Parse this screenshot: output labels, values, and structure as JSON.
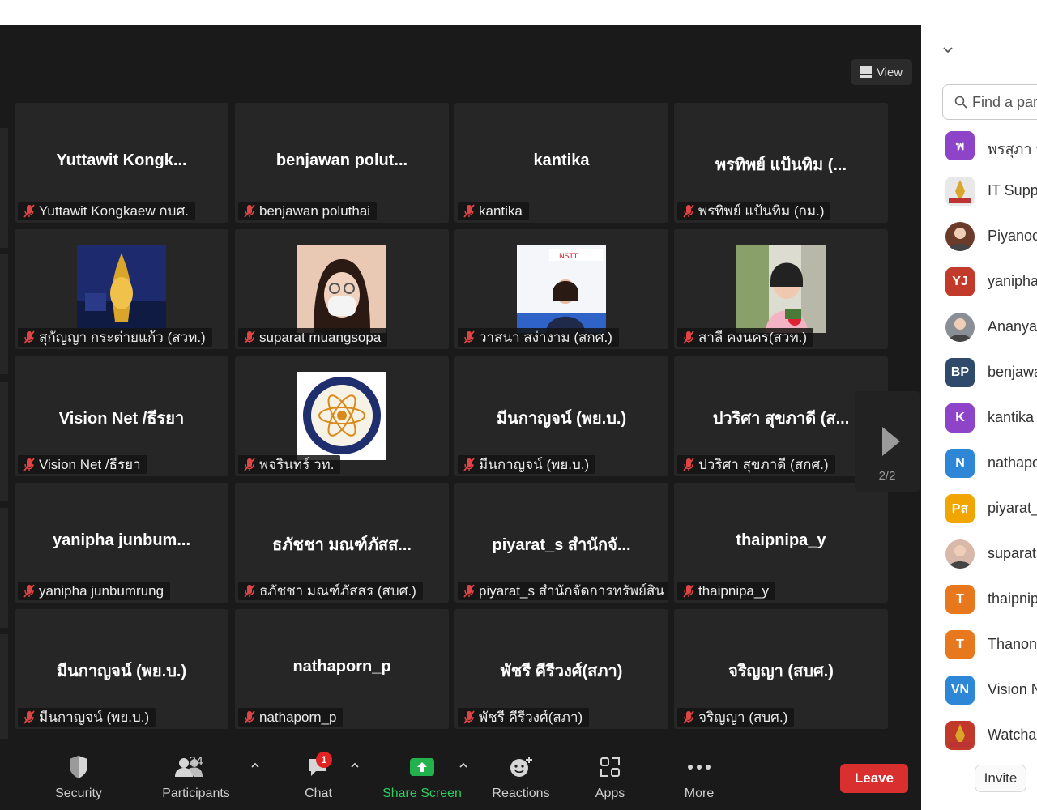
{
  "view_button": {
    "label": "View"
  },
  "tiles": [
    {
      "id": "r1c1",
      "big": "Yuttawit  Kongk...",
      "tag": "Yuttawit Kongkaew กบศ.",
      "video": false
    },
    {
      "id": "r1c2",
      "big": "benjawan  polut...",
      "tag": "benjawan poluthai",
      "video": false
    },
    {
      "id": "r1c3",
      "big": "kantika",
      "tag": "kantika",
      "video": false
    },
    {
      "id": "r1c4",
      "big": "พรทิพย์ แป้นทิม (...",
      "tag": "พรทิพย์ แป้นทิม (กม.)",
      "video": false
    },
    {
      "id": "r2c1",
      "big": "",
      "tag": "สุกัญญา กระต่ายแก้ว (สวท.)",
      "video": true
    },
    {
      "id": "r2c2",
      "big": "",
      "tag": "suparat muangsopa",
      "video": true
    },
    {
      "id": "r2c3",
      "big": "",
      "tag": "วาสนา สง่างาม (สกศ.)",
      "video": true
    },
    {
      "id": "r2c4",
      "big": "",
      "tag": "สาลี คงนคร(สวท.)",
      "video": true
    },
    {
      "id": "r3c1",
      "big": "Vision Net /ธีรยา",
      "tag": "Vision Net /ธีรยา",
      "video": false
    },
    {
      "id": "r3c2",
      "big": "",
      "tag": "พจรินทร์ วท.",
      "video": true
    },
    {
      "id": "r3c3",
      "big": "มีนกาญจน์ (พย.บ.)",
      "tag": "มีนกาญจน์ (พย.บ.)",
      "video": false
    },
    {
      "id": "r3c4",
      "big": "ปวริศา สุขภาดี (ส...",
      "tag": "ปวริศา สุขภาดี (สกศ.)",
      "video": false
    },
    {
      "id": "r4c1",
      "big": "yanipha  junbum...",
      "tag": "yanipha junbumrung",
      "video": false
    },
    {
      "id": "r4c2",
      "big": "ธภัชชา มณฑ์ภัสส...",
      "tag": "ธภัชชา มณฑ์ภัสสร (สบศ.)",
      "video": false
    },
    {
      "id": "r4c3",
      "big": "piyarat_s สำนักจั...",
      "tag": "piyarat_s สำนักจัดการทรัพย์สิน",
      "video": false
    },
    {
      "id": "r4c4",
      "big": "thaipnipa_y",
      "tag": "thaipnipa_y",
      "video": false
    },
    {
      "id": "r5c1",
      "big": "มีนกาญจน์ (พย.บ.)",
      "tag": "มีนกาญจน์ (พย.บ.)",
      "video": false
    },
    {
      "id": "r5c2",
      "big": "nathaporn_p",
      "tag": "nathaporn_p",
      "video": false
    },
    {
      "id": "r5c3",
      "big": "พัชรี คีรีวงศ์(สภา)",
      "tag": "พัชรี คีรีวงศ์(สภา)",
      "video": false
    },
    {
      "id": "r5c4",
      "big": "จริญญา (สบศ.)",
      "tag": "จริญญา (สบศ.)",
      "video": false
    }
  ],
  "pager": {
    "label": "2/2"
  },
  "toolbar": {
    "security": "Security",
    "participants": "Participants",
    "participants_count": "34",
    "chat": "Chat",
    "chat_badge": "1",
    "share_screen": "Share Screen",
    "reactions": "Reactions",
    "apps": "Apps",
    "more": "More",
    "leave": "Leave"
  },
  "panel": {
    "search_placeholder": "Find a par",
    "participants": [
      {
        "initials": "พ",
        "name": "พรสุภา น",
        "color": "#8e44c9",
        "kind": "initials"
      },
      {
        "initials": "",
        "name": "IT Supp",
        "color": "#e8e8e8",
        "kind": "logo"
      },
      {
        "initials": "",
        "name": "Piyanoc",
        "color": "#6b3b2a",
        "kind": "photo"
      },
      {
        "initials": "YJ",
        "name": "yanipha",
        "color": "#c23b2a",
        "kind": "initials"
      },
      {
        "initials": "",
        "name": "Ananya",
        "color": "#8a8f96",
        "kind": "photo"
      },
      {
        "initials": "BP",
        "name": "benjawa",
        "color": "#2f4a6b",
        "kind": "initials"
      },
      {
        "initials": "K",
        "name": "kantika",
        "color": "#8e44c9",
        "kind": "initials"
      },
      {
        "initials": "N",
        "name": "nathapo",
        "color": "#2e86d6",
        "kind": "initials"
      },
      {
        "initials": "Pส",
        "name": "piyarat_",
        "color": "#f0a500",
        "kind": "initials"
      },
      {
        "initials": "",
        "name": "suparat",
        "color": "#d8b8a8",
        "kind": "photo"
      },
      {
        "initials": "T",
        "name": "thaipnip",
        "color": "#e8781e",
        "kind": "initials"
      },
      {
        "initials": "T",
        "name": "Thanon",
        "color": "#e8781e",
        "kind": "initials"
      },
      {
        "initials": "VN",
        "name": "Vision N",
        "color": "#2e86d6",
        "kind": "initials"
      },
      {
        "initials": "",
        "name": "Watchar",
        "color": "#c0392b",
        "kind": "logo"
      }
    ],
    "invite": "Invite"
  }
}
